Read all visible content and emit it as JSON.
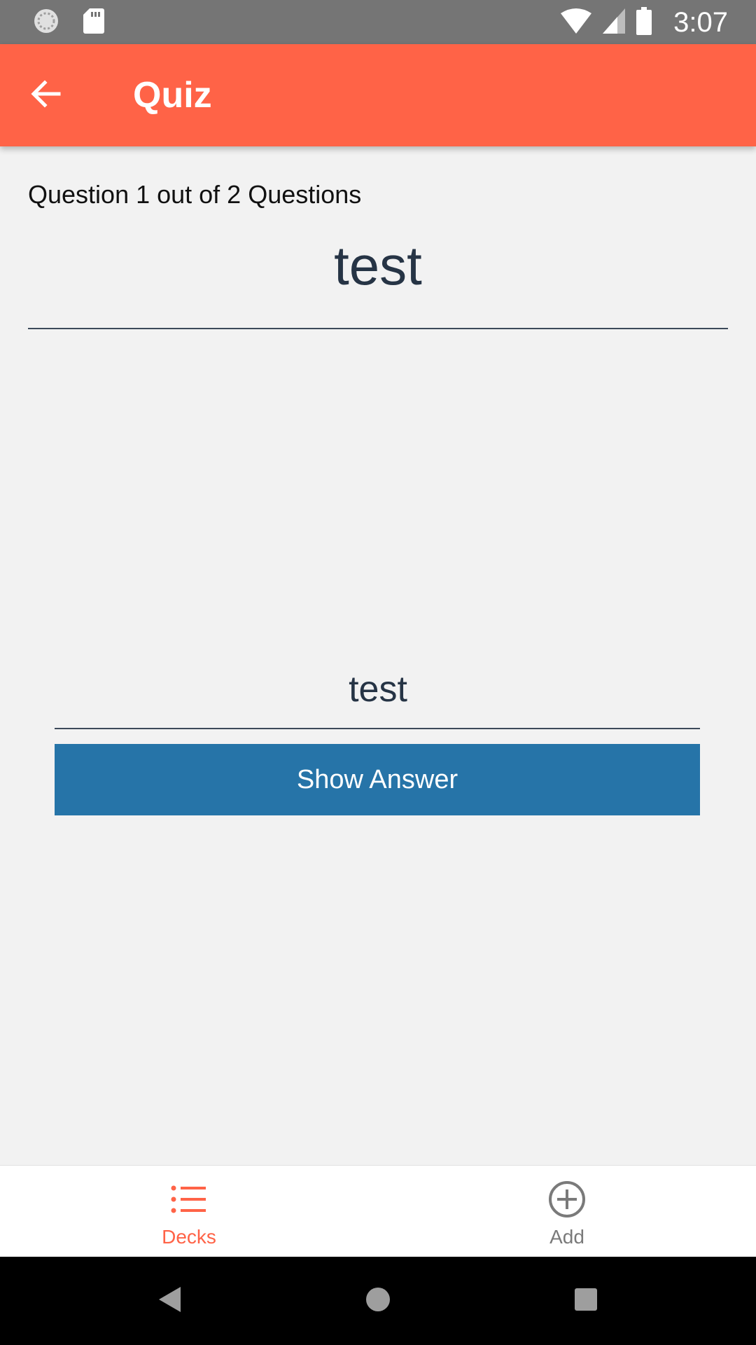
{
  "status_bar": {
    "time": "3:07",
    "icons": [
      "sync-icon",
      "sd-card-icon",
      "wifi-icon",
      "cellular-signal-icon",
      "battery-icon"
    ]
  },
  "app_bar": {
    "title": "Quiz",
    "back_icon": "arrow-back-icon",
    "background_color": "#ff6347"
  },
  "quiz": {
    "progress_text": "Question 1 out of 2 Questions",
    "question": "test",
    "answer": "test",
    "show_answer_label": "Show Answer",
    "button_color": "#2674a8"
  },
  "tabs": [
    {
      "label": "Decks",
      "icon": "list-icon",
      "active": true
    },
    {
      "label": "Add",
      "icon": "add-circle-icon",
      "active": false
    }
  ],
  "colors": {
    "accent": "#ff6347",
    "text_dark": "#263445",
    "inactive": "#7a7a7a"
  },
  "nav_bar": {
    "buttons": [
      "back-triangle-icon",
      "home-circle-icon",
      "recents-square-icon"
    ]
  }
}
